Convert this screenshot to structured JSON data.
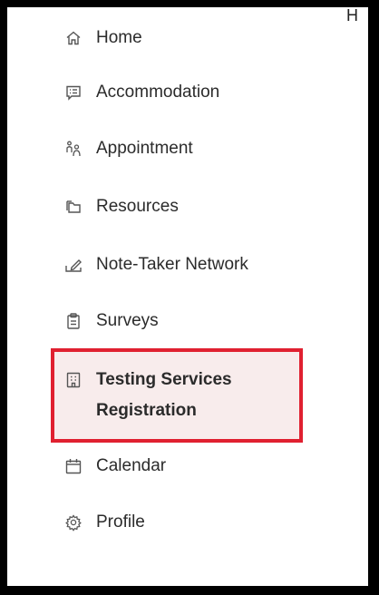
{
  "header": {
    "cut_text": "H"
  },
  "sidebar": {
    "items": [
      {
        "label": "Home",
        "icon": "home-icon"
      },
      {
        "label": "Accommodation",
        "icon": "list-icon"
      },
      {
        "label": "Appointment",
        "icon": "people-icon"
      },
      {
        "label": "Resources",
        "icon": "folder-icon"
      },
      {
        "label": "Note-Taker Network",
        "icon": "pen-icon"
      },
      {
        "label": "Surveys",
        "icon": "clipboard-icon"
      },
      {
        "label_line1": "Testing Services",
        "label_line2": "Registration",
        "icon": "building-icon",
        "active": true
      },
      {
        "label": "Calendar",
        "icon": "calendar-icon"
      },
      {
        "label": "Profile",
        "icon": "gear-icon"
      }
    ]
  },
  "colors": {
    "highlight_border": "#e02030",
    "highlight_fill": "#f8ecec",
    "text": "#2b2b2b",
    "frame": "#000000"
  }
}
